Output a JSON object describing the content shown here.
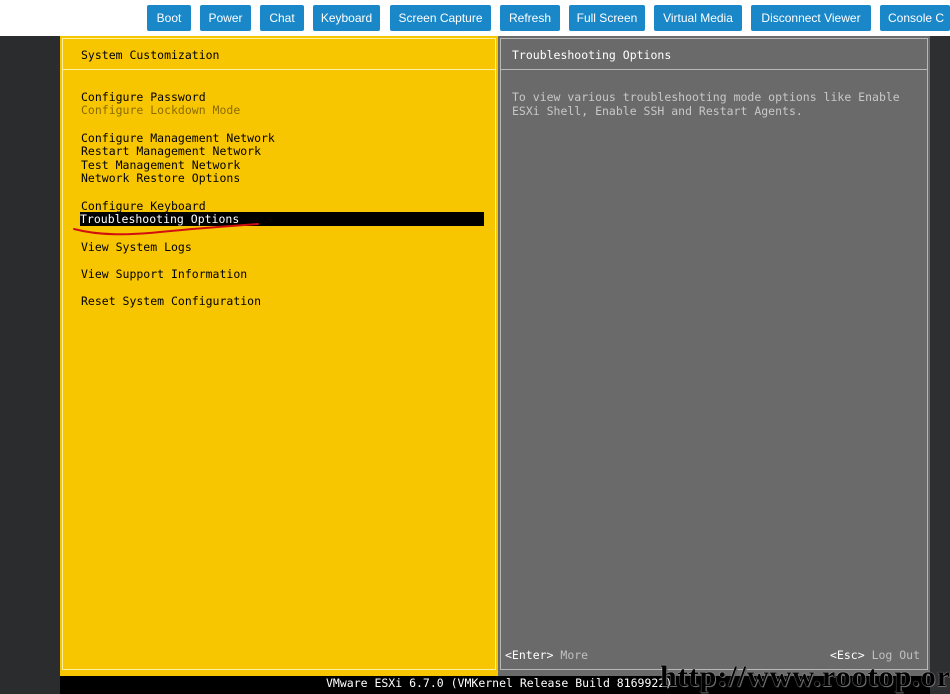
{
  "toolbar": {
    "buttons": [
      {
        "label": "Boot"
      },
      {
        "label": "Power"
      },
      {
        "label": "Chat"
      },
      {
        "label": "Keyboard"
      },
      {
        "label": "Screen Capture"
      },
      {
        "label": "Refresh"
      },
      {
        "label": "Full Screen"
      },
      {
        "label": "Virtual Media"
      },
      {
        "label": "Disconnect Viewer"
      },
      {
        "label": "Console C"
      }
    ],
    "color": "#1a87c8"
  },
  "dcui": {
    "left_title": "System Customization",
    "right_title": "Troubleshooting Options",
    "menu": [
      {
        "label": "Configure Password",
        "state": "normal"
      },
      {
        "label": "Configure Lockdown Mode",
        "state": "disabled"
      },
      {
        "label": "Configure Management Network",
        "state": "normal"
      },
      {
        "label": "Restart Management Network",
        "state": "normal"
      },
      {
        "label": "Test Management Network",
        "state": "normal"
      },
      {
        "label": "Network Restore Options",
        "state": "normal"
      },
      {
        "label": "Configure Keyboard",
        "state": "normal"
      },
      {
        "label": "Troubleshooting Options",
        "state": "selected"
      },
      {
        "label": "View System Logs",
        "state": "normal"
      },
      {
        "label": "View Support Information",
        "state": "normal"
      },
      {
        "label": "Reset System Configuration",
        "state": "normal"
      }
    ],
    "description_line1": "To view various troubleshooting mode options like Enable",
    "description_line2": "ESXi Shell, Enable SSH and Restart Agents.",
    "enter_key": "<Enter>",
    "enter_action": "More",
    "esc_key": "<Esc>",
    "esc_action": "Log Out",
    "colors": {
      "left_pane": "#f8c600",
      "right_pane": "#6a6a6a",
      "annotation": "#d01010"
    }
  },
  "footer": {
    "text": "VMware ESXi 6.7.0 (VMKernel Release Build 8169922)"
  },
  "watermark": "http://www.rootop.org"
}
